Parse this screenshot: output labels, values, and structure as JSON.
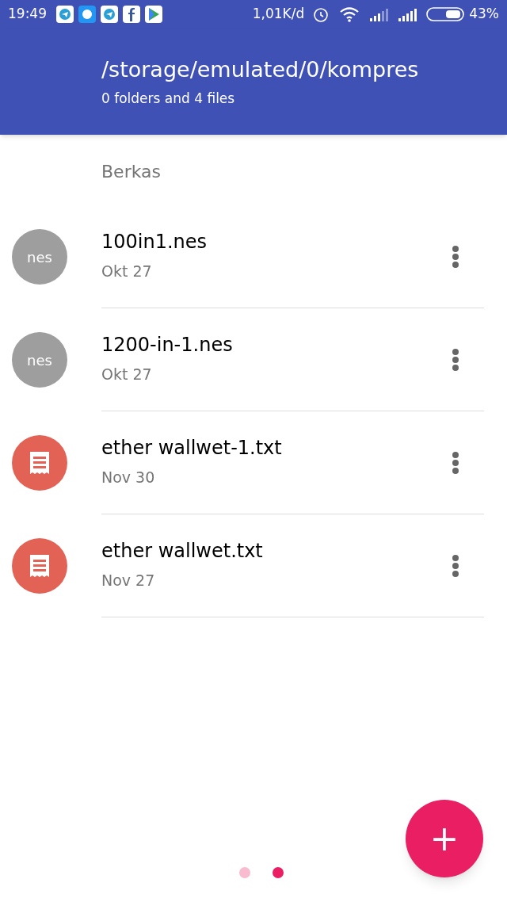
{
  "status_bar": {
    "time": "19:49",
    "network_speed": "1,01K/d",
    "battery": "43%"
  },
  "header": {
    "title": "/storage/emulated/0/kompres",
    "subtitle": "0 folders and 4 files"
  },
  "section": {
    "title": "Berkas"
  },
  "files": [
    {
      "kind": "nes",
      "badge": "nes",
      "name": "100in1.nes",
      "date": "Okt 27"
    },
    {
      "kind": "nes",
      "badge": "nes",
      "name": "1200-in-1.nes",
      "date": "Okt 27"
    },
    {
      "kind": "text",
      "name": "ether wallwet-1.txt",
      "date": "Nov 30"
    },
    {
      "kind": "text",
      "name": "ether wallwet.txt",
      "date": "Nov 27"
    }
  ],
  "fab": {
    "label": "+"
  },
  "pages": [
    {
      "selected": false
    },
    {
      "selected": true
    }
  ]
}
